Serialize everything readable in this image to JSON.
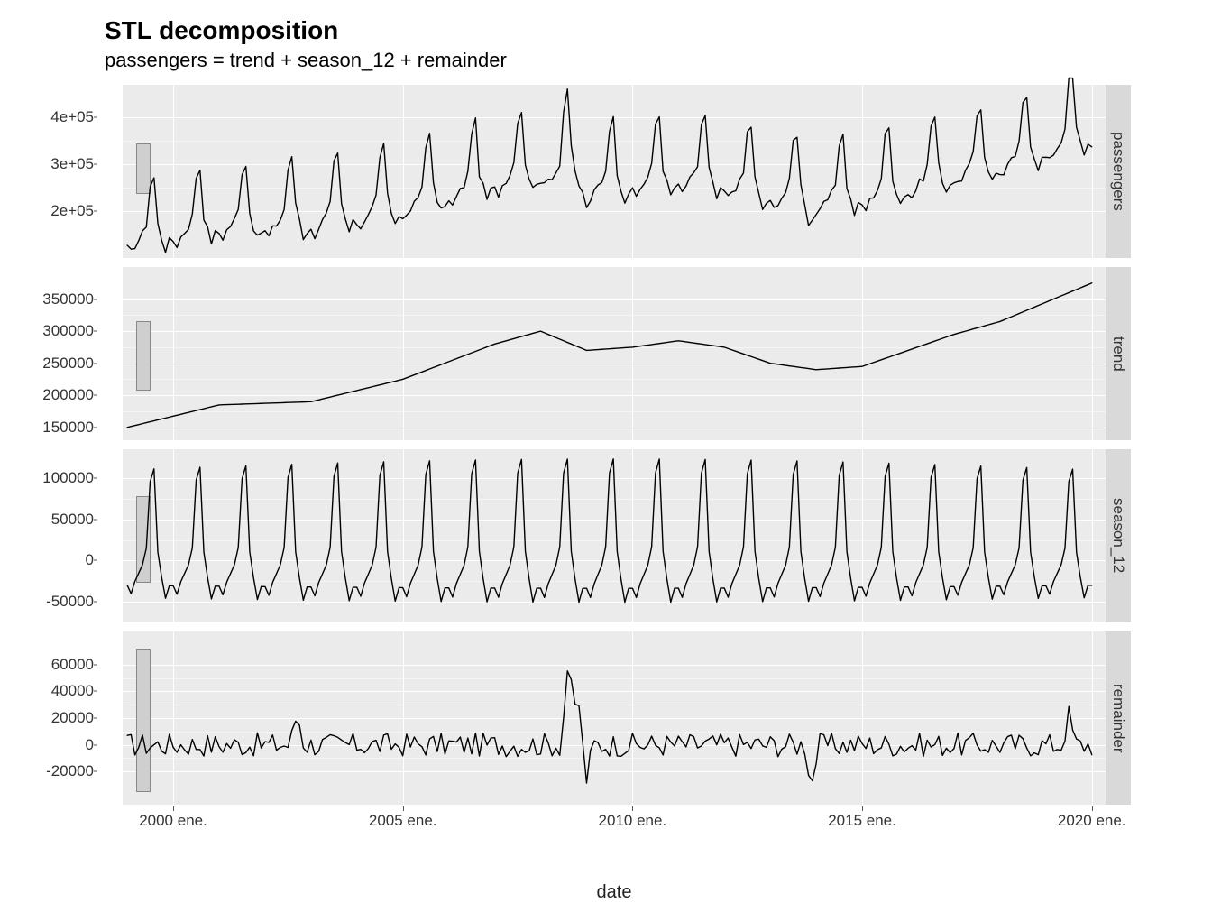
{
  "title": "STL decomposition",
  "subtitle": "passengers = trend + season_12 + remainder",
  "xlabel": "date",
  "x_range_years": [
    1998.9,
    2020.3
  ],
  "x_ticks": [
    {
      "year": 2000,
      "label": "2000 ene."
    },
    {
      "year": 2005,
      "label": "2005 ene."
    },
    {
      "year": 2010,
      "label": "2010 ene."
    },
    {
      "year": 2015,
      "label": "2015 ene."
    },
    {
      "year": 2020,
      "label": "2020 ene."
    }
  ],
  "panels": [
    {
      "id": "passengers",
      "strip": "passengers",
      "ylim": [
        100000,
        470000
      ],
      "yticks": [
        {
          "v": 200000,
          "l": "2e+05"
        },
        {
          "v": 300000,
          "l": "3e+05"
        },
        {
          "v": 400000,
          "l": "4e+05"
        }
      ],
      "rangebar": {
        "top": 240000,
        "bottom": 345000,
        "x": 15
      }
    },
    {
      "id": "trend",
      "strip": "trend",
      "ylim": [
        130000,
        400000
      ],
      "yticks": [
        {
          "v": 150000,
          "l": "150000"
        },
        {
          "v": 200000,
          "l": "200000"
        },
        {
          "v": 250000,
          "l": "250000"
        },
        {
          "v": 300000,
          "l": "300000"
        },
        {
          "v": 350000,
          "l": "350000"
        }
      ],
      "rangebar": {
        "top": 210000,
        "bottom": 315000,
        "x": 15
      }
    },
    {
      "id": "season_12",
      "strip": "season_12",
      "ylim": [
        -75000,
        135000
      ],
      "yticks": [
        {
          "v": -50000,
          "l": "-50000"
        },
        {
          "v": 0,
          "l": "0"
        },
        {
          "v": 50000,
          "l": "50000"
        },
        {
          "v": 100000,
          "l": "100000"
        }
      ],
      "rangebar": {
        "top": -25000,
        "bottom": 78000,
        "x": 15
      }
    },
    {
      "id": "remainder",
      "strip": "remainder",
      "ylim": [
        -45000,
        85000
      ],
      "yticks": [
        {
          "v": -20000,
          "l": "-20000"
        },
        {
          "v": 0,
          "l": "0"
        },
        {
          "v": 20000,
          "l": "20000"
        },
        {
          "v": 40000,
          "l": "40000"
        },
        {
          "v": 60000,
          "l": "60000"
        }
      ],
      "rangebar": {
        "top": -34000,
        "bottom": 72000,
        "x": 15
      }
    }
  ],
  "chart_data": {
    "type": "line",
    "title": "STL decomposition",
    "subtitle": "passengers = trend + season_12 + remainder",
    "xlabel": "date",
    "x_start_year": 1999,
    "x_months": 253,
    "series": [
      {
        "name": "passengers",
        "ylim": [
          100000,
          470000
        ]
      },
      {
        "name": "trend",
        "ylim": [
          130000,
          400000
        ]
      },
      {
        "name": "season_12",
        "ylim": [
          -75000,
          135000
        ]
      },
      {
        "name": "remainder",
        "ylim": [
          -45000,
          85000
        ]
      }
    ],
    "season_pattern": [
      -30000,
      -40000,
      -25000,
      -15000,
      -5000,
      15000,
      95000,
      110000,
      10000,
      -20000,
      -45000,
      -30000
    ],
    "trend_anchors": [
      {
        "year": 1999,
        "v": 150000
      },
      {
        "year": 2001,
        "v": 185000
      },
      {
        "year": 2003,
        "v": 190000
      },
      {
        "year": 2005,
        "v": 225000
      },
      {
        "year": 2007,
        "v": 280000
      },
      {
        "year": 2008,
        "v": 300000
      },
      {
        "year": 2009,
        "v": 270000
      },
      {
        "year": 2010,
        "v": 275000
      },
      {
        "year": 2011,
        "v": 285000
      },
      {
        "year": 2012,
        "v": 275000
      },
      {
        "year": 2013,
        "v": 250000
      },
      {
        "year": 2014,
        "v": 240000
      },
      {
        "year": 2015,
        "v": 245000
      },
      {
        "year": 2016,
        "v": 270000
      },
      {
        "year": 2017,
        "v": 295000
      },
      {
        "year": 2018,
        "v": 315000
      },
      {
        "year": 2019,
        "v": 345000
      },
      {
        "year": 2020,
        "v": 375000
      }
    ],
    "remainder_noise_sd": 9000,
    "remainder_spikes": [
      {
        "year": 2008.6,
        "v": 65000
      },
      {
        "year": 2008.8,
        "v": 40000
      },
      {
        "year": 2009.0,
        "v": -25000
      },
      {
        "year": 2002.7,
        "v": 25000
      },
      {
        "year": 2013.9,
        "v": -30000
      },
      {
        "year": 2019.5,
        "v": 22000
      }
    ]
  }
}
